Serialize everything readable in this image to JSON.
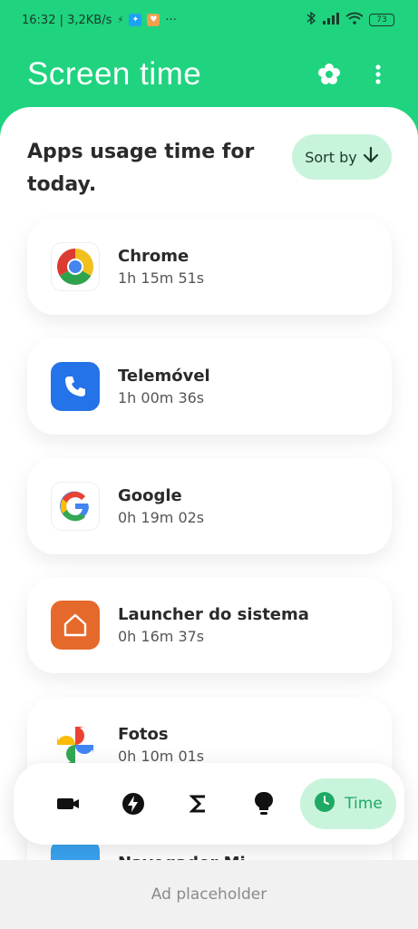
{
  "status": {
    "time_speed": "16:32 | 3,2KB/s",
    "overflow": "···",
    "battery": "73"
  },
  "header": {
    "title": "Screen time"
  },
  "main": {
    "heading": "Apps usage time for today.",
    "sort_label": "Sort by",
    "apps": [
      {
        "name": "Chrome",
        "time": "1h 15m 51s"
      },
      {
        "name": "Telemóvel",
        "time": "1h 00m 36s"
      },
      {
        "name": "Google",
        "time": "0h 19m 02s"
      },
      {
        "name": "Launcher do sistema",
        "time": "0h 16m 37s"
      },
      {
        "name": "Fotos",
        "time": "0h 10m 01s"
      },
      {
        "name": "Navegador Mi",
        "time": ""
      }
    ]
  },
  "nav": {
    "items": [
      "camera-icon",
      "lightning-icon",
      "sigma-icon",
      "lightbulb-icon",
      "clock-icon"
    ],
    "active_label": "Time"
  },
  "ad": {
    "label": "Ad placeholder"
  },
  "colors": {
    "brand": "#1fd37f",
    "accent_light": "#c9f4dc",
    "accent_text": "#1ea964"
  }
}
